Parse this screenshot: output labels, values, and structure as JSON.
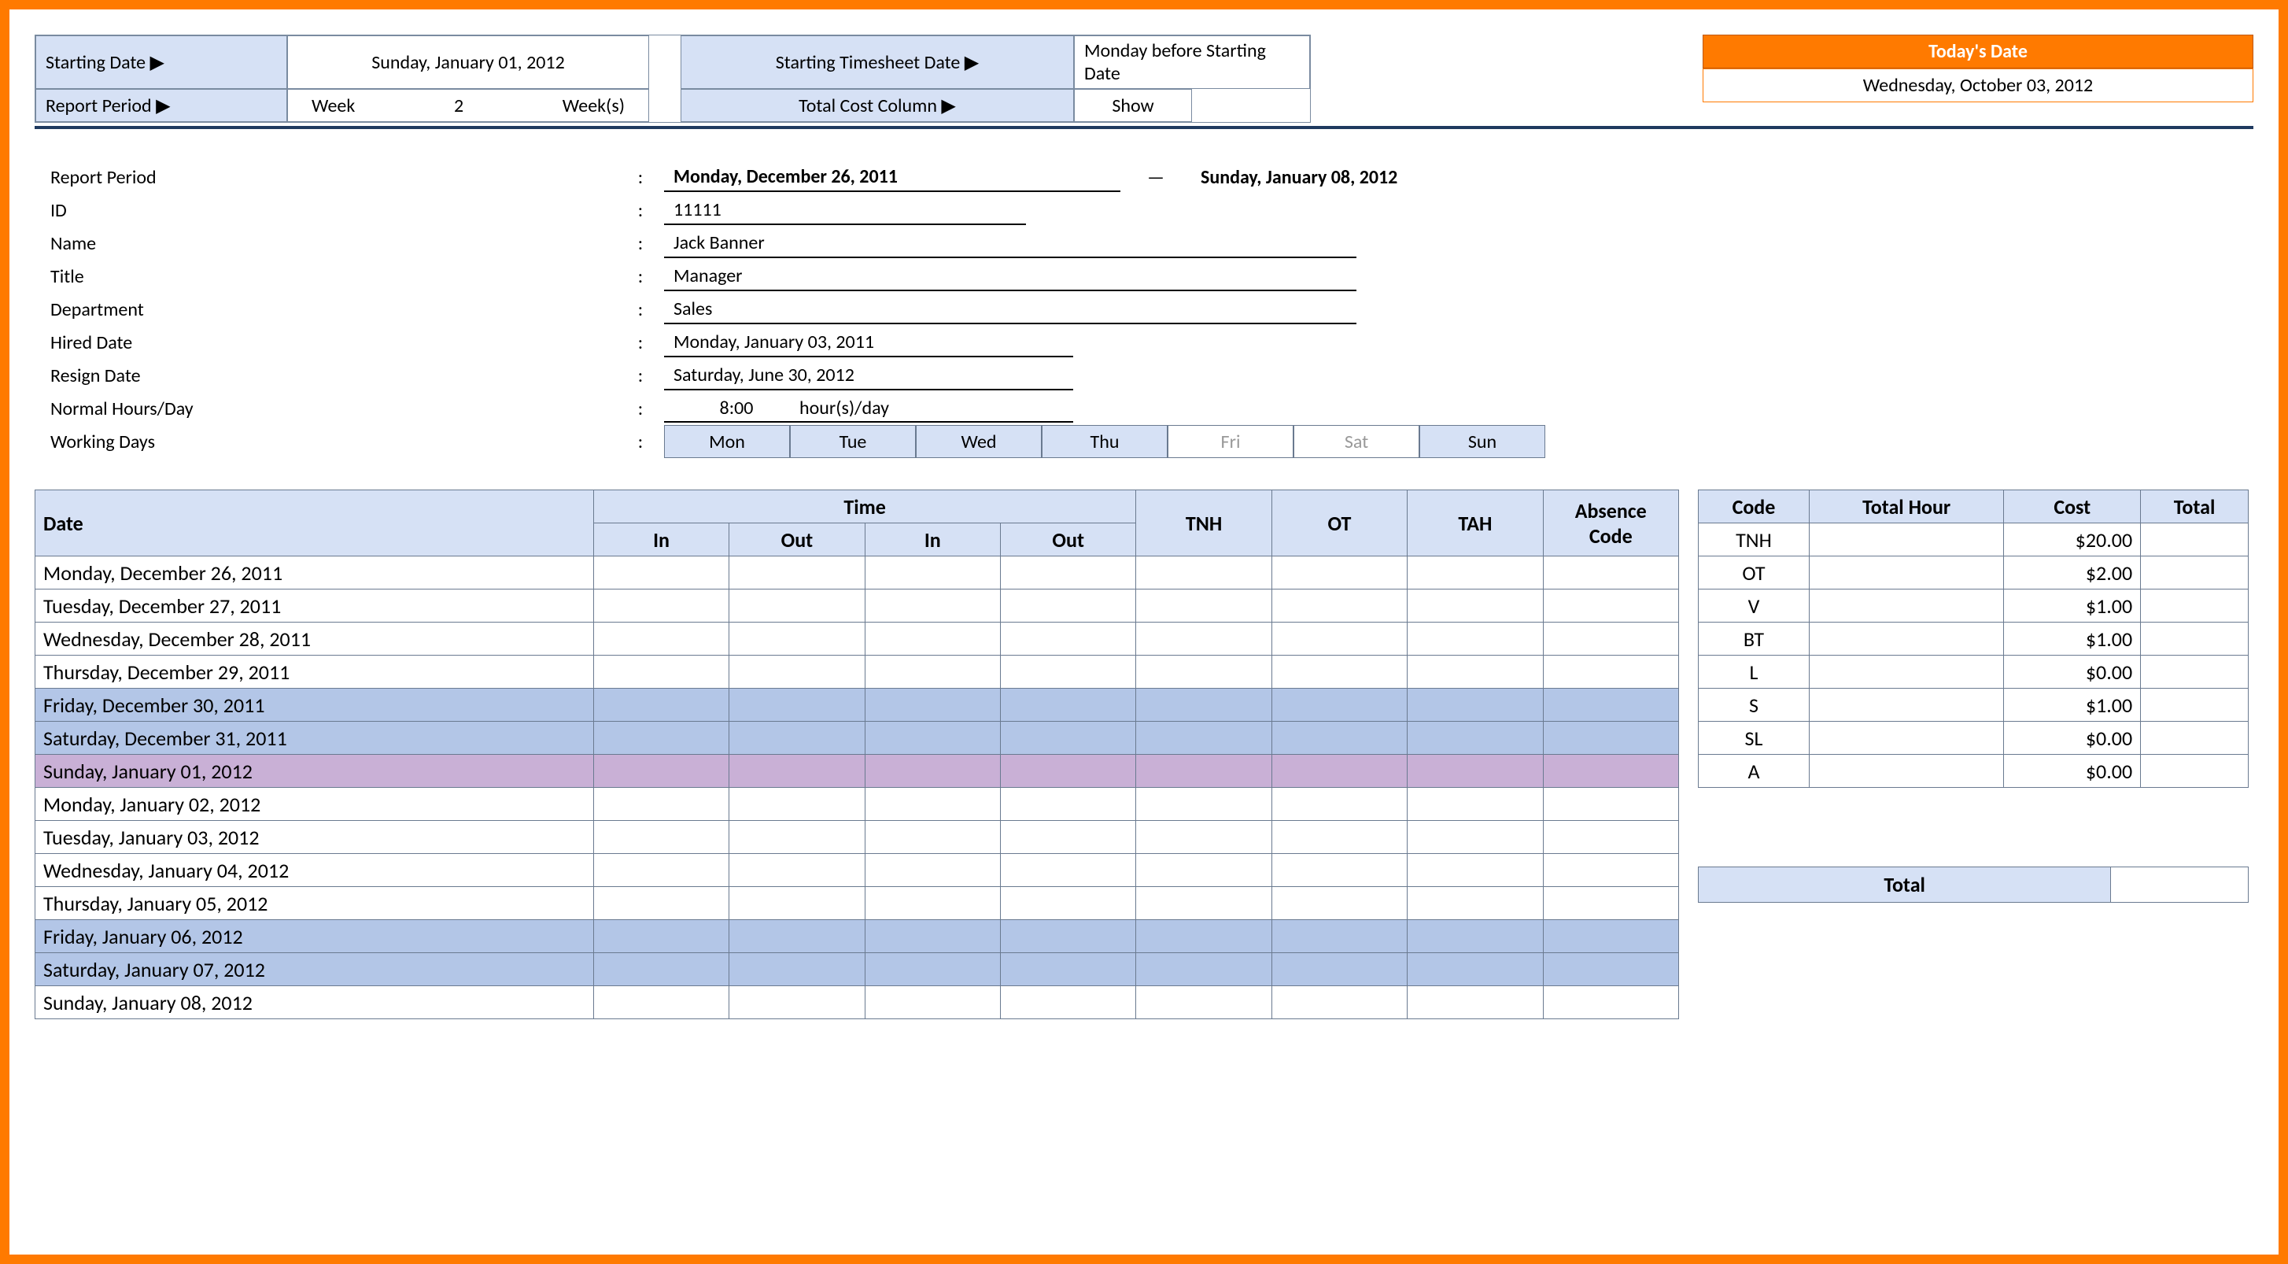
{
  "header": {
    "starting_date_label": "Starting Date ▶",
    "starting_date_value": "Sunday, January 01, 2012",
    "starting_ts_label": "Starting Timesheet Date ▶",
    "starting_ts_value": "Monday before Starting Date",
    "report_period_label": "Report Period ▶",
    "report_period_unit": "Week",
    "report_period_num": "2",
    "report_period_suffix": "Week(s)",
    "total_cost_label": "Total Cost Column ▶",
    "total_cost_value": "Show",
    "today_label": "Today's Date",
    "today_value": "Wednesday, October 03, 2012"
  },
  "info": {
    "report_period_label": "Report Period",
    "report_start": "Monday, December 26, 2011",
    "report_dash": "—",
    "report_end": "Sunday, January 08, 2012",
    "id_label": "ID",
    "id": "11111",
    "name_label": "Name",
    "name": "Jack Banner",
    "title_label": "Title",
    "title": "Manager",
    "department_label": "Department",
    "department": "Sales",
    "hired_label": "Hired Date",
    "hired": "Monday, January 03, 2011",
    "resign_label": "Resign Date",
    "resign": "Saturday, June 30, 2012",
    "normal_label": "Normal Hours/Day",
    "normal_val": "8:00",
    "normal_suffix": "hour(s)/day",
    "working_label": "Working Days",
    "days": [
      "Mon",
      "Tue",
      "Wed",
      "Thu",
      "Fri",
      "Sat",
      "Sun"
    ],
    "days_active": [
      true,
      true,
      true,
      true,
      false,
      false,
      true
    ]
  },
  "timesheet": {
    "h_date": "Date",
    "h_time": "Time",
    "h_in": "In",
    "h_out": "Out",
    "h_tnh": "TNH",
    "h_ot": "OT",
    "h_tah": "TAH",
    "h_abs": "Absence Code",
    "rows": [
      {
        "date": "Monday, December 26, 2011",
        "cls": ""
      },
      {
        "date": "Tuesday, December 27, 2011",
        "cls": ""
      },
      {
        "date": "Wednesday, December 28, 2011",
        "cls": ""
      },
      {
        "date": "Thursday, December 29, 2011",
        "cls": ""
      },
      {
        "date": "Friday, December 30, 2011",
        "cls": "row-weekend"
      },
      {
        "date": "Saturday, December 31, 2011",
        "cls": "row-weekend"
      },
      {
        "date": "Sunday, January 01, 2012",
        "cls": "row-newyear"
      },
      {
        "date": "Monday, January 02, 2012",
        "cls": ""
      },
      {
        "date": "Tuesday, January 03, 2012",
        "cls": ""
      },
      {
        "date": "Wednesday, January 04, 2012",
        "cls": ""
      },
      {
        "date": "Thursday, January 05, 2012",
        "cls": ""
      },
      {
        "date": "Friday, January 06, 2012",
        "cls": "row-weekend"
      },
      {
        "date": "Saturday, January 07, 2012",
        "cls": "row-weekend"
      },
      {
        "date": "Sunday, January 08, 2012",
        "cls": ""
      }
    ]
  },
  "cost": {
    "h_code": "Code",
    "h_total_hour": "Total Hour",
    "h_cost": "Cost",
    "h_total": "Total",
    "rows": [
      {
        "code": "TNH",
        "cost": "$20.00"
      },
      {
        "code": "OT",
        "cost": "$2.00"
      },
      {
        "code": "V",
        "cost": "$1.00"
      },
      {
        "code": "BT",
        "cost": "$1.00"
      },
      {
        "code": "L",
        "cost": "$0.00"
      },
      {
        "code": "S",
        "cost": "$1.00"
      },
      {
        "code": "SL",
        "cost": "$0.00"
      },
      {
        "code": "A",
        "cost": "$0.00"
      }
    ],
    "total_label": "Total"
  }
}
